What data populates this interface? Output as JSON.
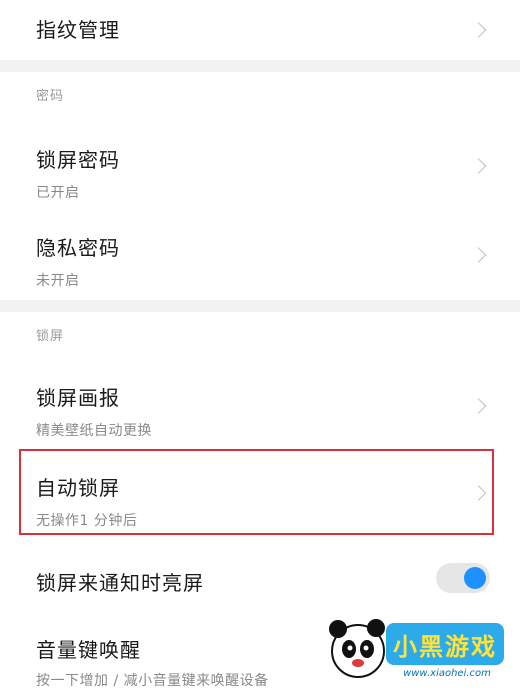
{
  "items": {
    "fingerprint": {
      "title": "指纹管理"
    },
    "lock_password": {
      "title": "锁屏密码",
      "sub": "已开启"
    },
    "privacy_password": {
      "title": "隐私密码",
      "sub": "未开启"
    },
    "lock_wallpaper": {
      "title": "锁屏画报",
      "sub": "精美壁纸自动更换"
    },
    "auto_lock": {
      "title": "自动锁屏",
      "sub": "无操作1 分钟后"
    },
    "wake_on_notify": {
      "title": "锁屏来通知时亮屏",
      "toggle_on": true
    },
    "volume_wake": {
      "title": "音量键唤醒",
      "sub": "按一下增加 / 减小音量键来唤醒设备"
    }
  },
  "sections": {
    "password": "密码",
    "lock_screen": "锁屏"
  },
  "watermark": {
    "brand": "小黑游戏",
    "url": "www.xiaohei.com"
  },
  "colors": {
    "highlight_border": "#d9333a",
    "toggle_knob": "#1e90ff",
    "section_gap": "#f2f2f2"
  }
}
